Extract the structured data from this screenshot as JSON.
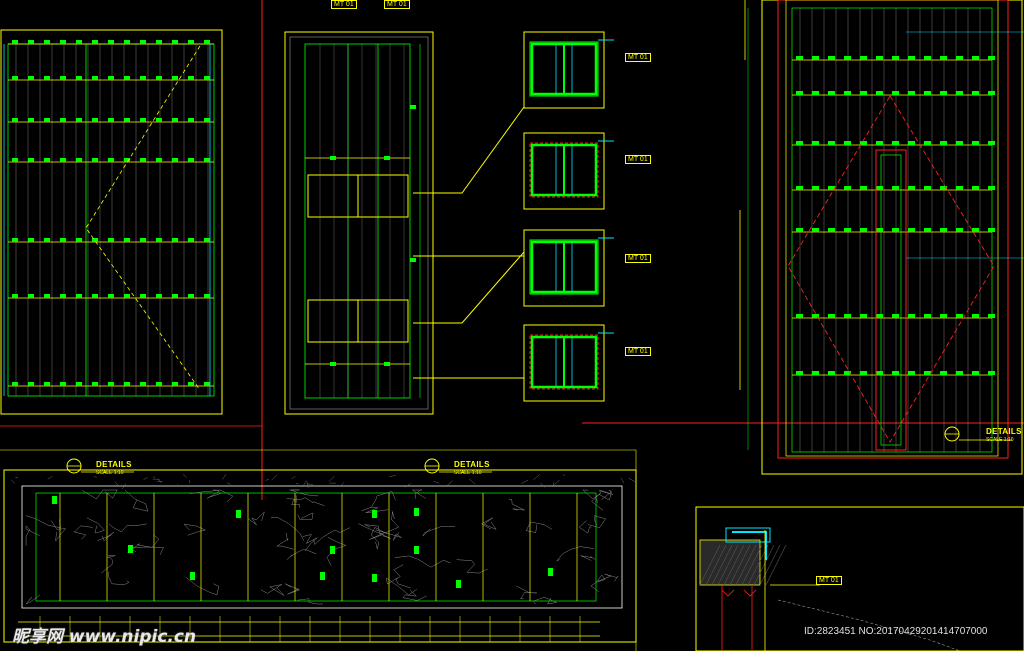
{
  "details": [
    {
      "label": "DETAILS",
      "scale": "SCALE 1:10"
    },
    {
      "label": "DETAILS",
      "scale": "SCALE 1:10"
    },
    {
      "label": "DETAILS",
      "scale": "SCALE 1:10"
    }
  ],
  "material_tags": [
    "MT 01",
    "MT 01",
    "MT 01",
    "MT 01",
    "MT 01",
    "MT 01",
    "MT 01"
  ],
  "watermark": {
    "site": "昵享网 www.nipic.cn",
    "id_text": "ID:2823451 NO:20170429201414707000"
  },
  "colors": {
    "background": "#000000",
    "yellow": "#ffff00",
    "green": "#00ff00",
    "cyan": "#00e5ff",
    "red": "#ff2020",
    "white": "#ffffff",
    "grey": "#9a9a9a"
  }
}
